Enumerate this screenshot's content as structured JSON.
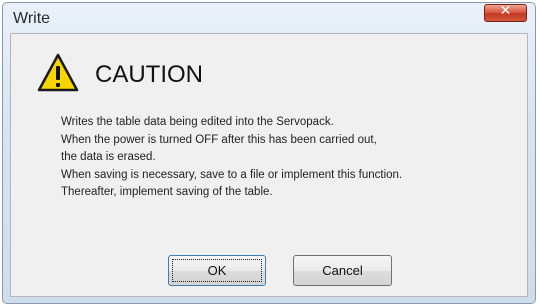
{
  "window": {
    "title": "Write",
    "close_symbol": "✕"
  },
  "dialog": {
    "icon": "warning-triangle-icon",
    "heading": "CAUTION",
    "message_lines": [
      "Writes the table data being edited into the Servopack.",
      "When the power is turned OFF after this has been carried out,",
      "the data is erased.",
      "When saving is necessary, save to a file or implement this function.",
      "Thereafter, implement saving of the table."
    ]
  },
  "buttons": {
    "ok_label": "OK",
    "cancel_label": "Cancel"
  },
  "colors": {
    "warning_fill": "#f7d600",
    "close_button": "#c84630"
  }
}
